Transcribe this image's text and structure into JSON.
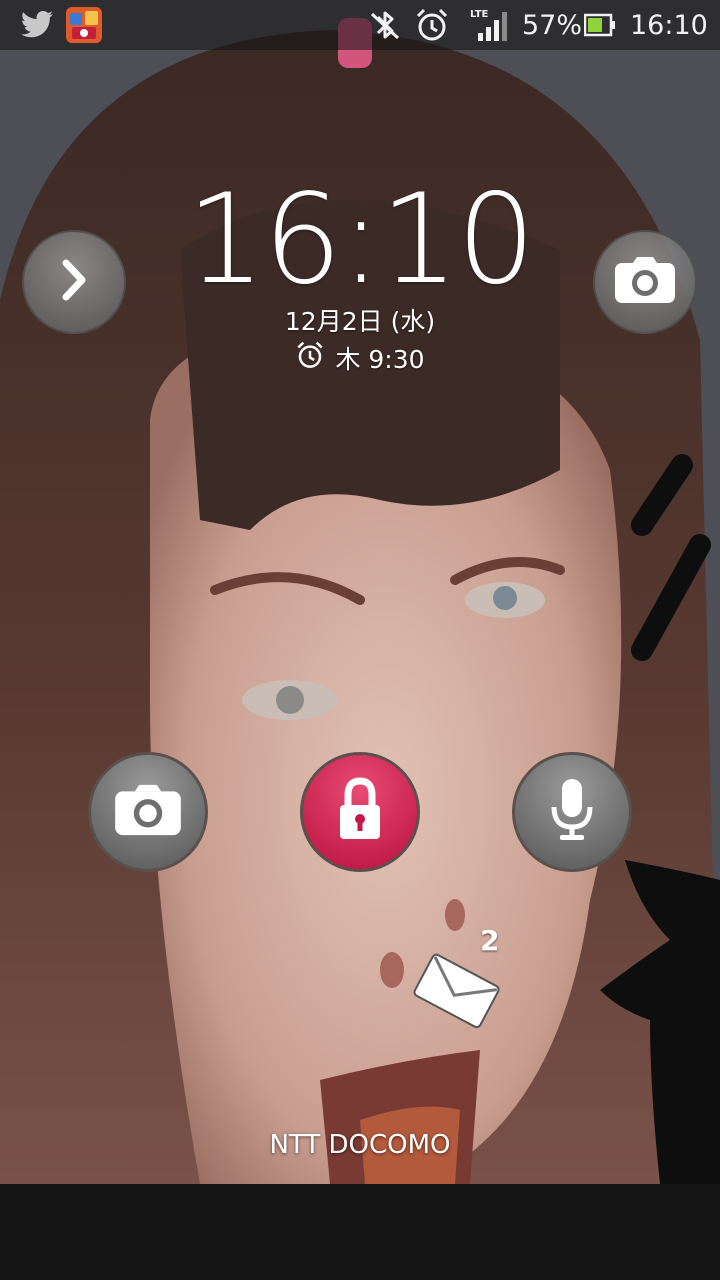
{
  "status_bar": {
    "battery_percent": "57%",
    "time": "16:10",
    "network_type": "LTE",
    "icons": [
      "twitter-icon",
      "app-game-icon",
      "bluetooth-off-icon",
      "alarm-icon",
      "signal-icon",
      "battery-icon"
    ]
  },
  "lock_screen": {
    "time": "16:10",
    "date": "12月2日 (水)",
    "next_alarm": "木 9:30",
    "carrier": "NTT DOCOMO"
  },
  "shortcuts": {
    "left_arrow": "chevron-right-icon",
    "top_camera": "camera-icon",
    "bottom_buttons": [
      "camera-icon",
      "lock-icon",
      "microphone-icon"
    ]
  },
  "notifications": {
    "mail_count": "2"
  },
  "colors": {
    "lock_button": "#c8174a",
    "round_button": "#7a7a7a"
  }
}
